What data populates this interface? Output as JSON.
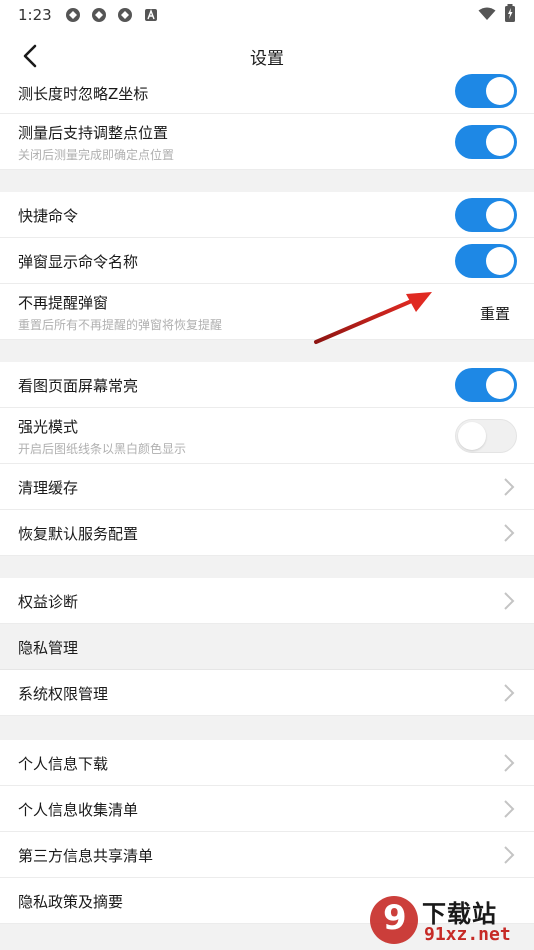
{
  "status": {
    "time": "1:23"
  },
  "header": {
    "title": "设置"
  },
  "rows": {
    "ignore_z": "测长度时忽略Z坐标",
    "adjust_point": {
      "label": "测量后支持调整点位置",
      "sub": "关闭后测量完成即确定点位置"
    },
    "quick_cmd": "快捷命令",
    "popup_cmd_name": "弹窗显示命令名称",
    "no_remind": {
      "label": "不再提醒弹窗",
      "sub": "重置后所有不再提醒的弹窗将恢复提醒",
      "action": "重置"
    },
    "screen_on": "看图页面屏幕常亮",
    "strong_light": {
      "label": "强光模式",
      "sub": "开启后图纸线条以黑白颜色显示"
    },
    "clear_cache": "清理缓存",
    "restore_default": "恢复默认服务配置",
    "rights_diag": "权益诊断",
    "privacy_section": "隐私管理",
    "sys_permission": "系统权限管理",
    "personal_download": "个人信息下载",
    "personal_collect": "个人信息收集清单",
    "third_party": "第三方信息共享清单",
    "privacy_policy": "隐私政策及摘要"
  },
  "toggles": {
    "ignore_z": true,
    "adjust_point": true,
    "quick_cmd": true,
    "popup_cmd_name": true,
    "screen_on": true,
    "strong_light": false
  },
  "watermark": {
    "brand": "下载站",
    "domain": "91xz.net",
    "mark": "9"
  },
  "colors": {
    "accent": "#1e88e5",
    "arrow": "#d9201e",
    "watermark": "#c62a26"
  }
}
